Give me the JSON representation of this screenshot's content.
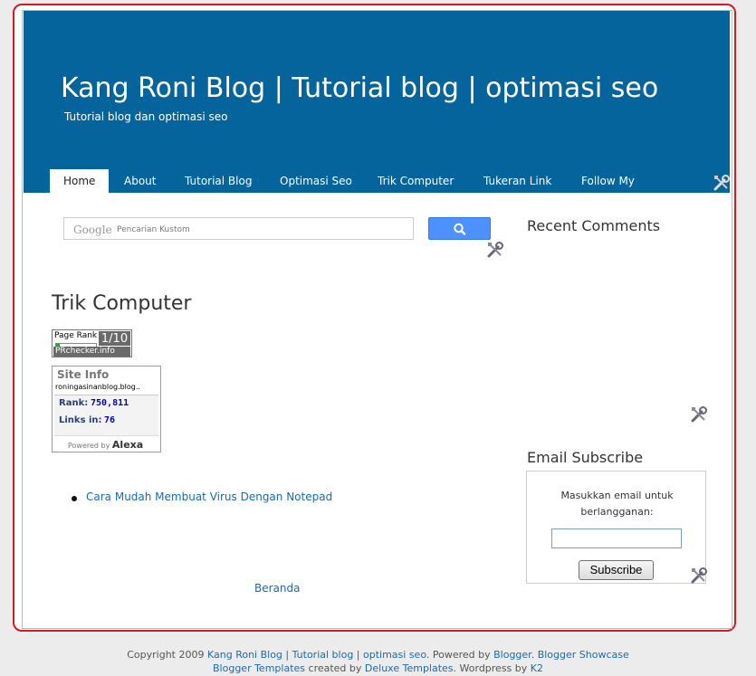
{
  "header": {
    "title": "Kang Roni Blog | Tutorial blog | optimasi seo",
    "description": "Tutorial blog dan optimasi seo"
  },
  "nav": {
    "items": [
      {
        "label": "Home",
        "active": true
      },
      {
        "label": "About"
      },
      {
        "label": "Tutorial Blog"
      },
      {
        "label": "Optimasi Seo"
      },
      {
        "label": "Trik Computer"
      },
      {
        "label": "Tukeran Link"
      },
      {
        "label": "Follow My"
      }
    ]
  },
  "search": {
    "brand": "Google",
    "placeholder": "Pencarian Kustom"
  },
  "main": {
    "page_title": "Trik Computer",
    "posts": [
      {
        "title": "Cara Mudah Membuat Virus Dengan Notepad"
      }
    ],
    "home_link": "Beranda"
  },
  "pagerank": {
    "label": "Page Rank",
    "score": "1/10",
    "fraction": 0.1,
    "site": "PRchecker.info"
  },
  "alexa": {
    "title": "Site Info",
    "domain": "roningasinanblog.blog..",
    "rank_label": "Rank:",
    "rank_value": "750,811",
    "links_label": "Links in:",
    "links_value": "76",
    "powered_by": "Powered by",
    "brand": "Alexa"
  },
  "sidebar": {
    "recent_comments_title": "Recent Comments",
    "email_subscribe_title": "Email Subscribe",
    "subscribe_prompt": "Masukkan email untuk berlangganan:",
    "subscribe_button": "Subscribe"
  },
  "footer": {
    "copyright": "Copyright 2009",
    "site_link": "Kang Roni Blog | Tutorial blog | optimasi seo",
    "powered_by": ". Powered by",
    "blogger": "Blogger",
    "sep1": ".",
    "showcase": "Blogger Showcase",
    "templates": "Blogger Templates",
    "created_by": "created by",
    "deluxe": "Deluxe Templates",
    "wordpress_by": ". Wordpress by",
    "k2": "K2"
  },
  "colors": {
    "header_bg": "#05649b",
    "frame_border": "#d71a21",
    "link": "#1a6ab0",
    "search_button": "#4d90fe"
  },
  "icons": {
    "widget_edit": "wrench-screwdriver-icon",
    "search": "magnifier-icon"
  }
}
